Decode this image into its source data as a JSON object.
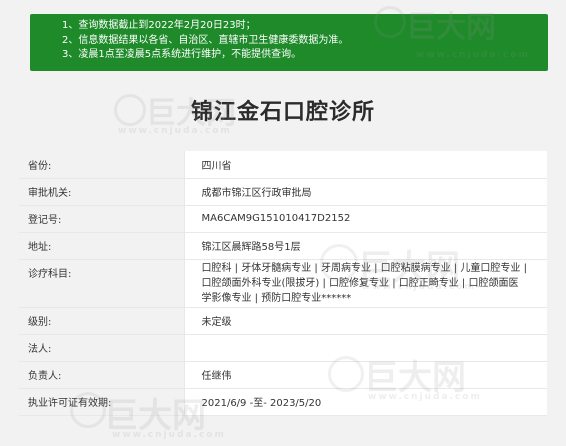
{
  "notice": {
    "lines": [
      "1、查询数据截止到2022年2月20日23时；",
      "2、信息数据结果以各省、自治区、直辖市卫生健康委数据为准。",
      "3、凌晨1点至凌晨5点系统进行维护，不能提供查询。"
    ]
  },
  "title": "锦江金石口腔诊所",
  "rows": [
    {
      "label": "省份:",
      "value": "四川省"
    },
    {
      "label": "审批机关:",
      "value": "成都市锦江区行政审批局"
    },
    {
      "label": "登记号:",
      "value": "MA6CAM9G151010417D2152"
    },
    {
      "label": "地址:",
      "value": "锦江区晨辉路58号1层"
    },
    {
      "label": "诊疗科目:",
      "value": "口腔科 | 牙体牙髓病专业 | 牙周病专业 | 口腔粘膜病专业 | 儿童口腔专业 | 口腔颌面外科专业(限拔牙) | 口腔修复专业 | 口腔正畸专业 | 口腔颌面医学影像专业 | 预防口腔专业******"
    },
    {
      "label": "级别:",
      "value": "未定级"
    },
    {
      "label": "法人:",
      "value": ""
    },
    {
      "label": "负责人:",
      "value": "任继伟"
    },
    {
      "label": "执业许可证有效期:",
      "value": "2021/6/9 -至- 2023/5/20"
    }
  ],
  "watermark": {
    "brand": "巨大网",
    "url": "www.cnjuda.com"
  },
  "colors": {
    "notice_bg": "#1e8a2a",
    "label_bg": "#f2f2f2"
  }
}
